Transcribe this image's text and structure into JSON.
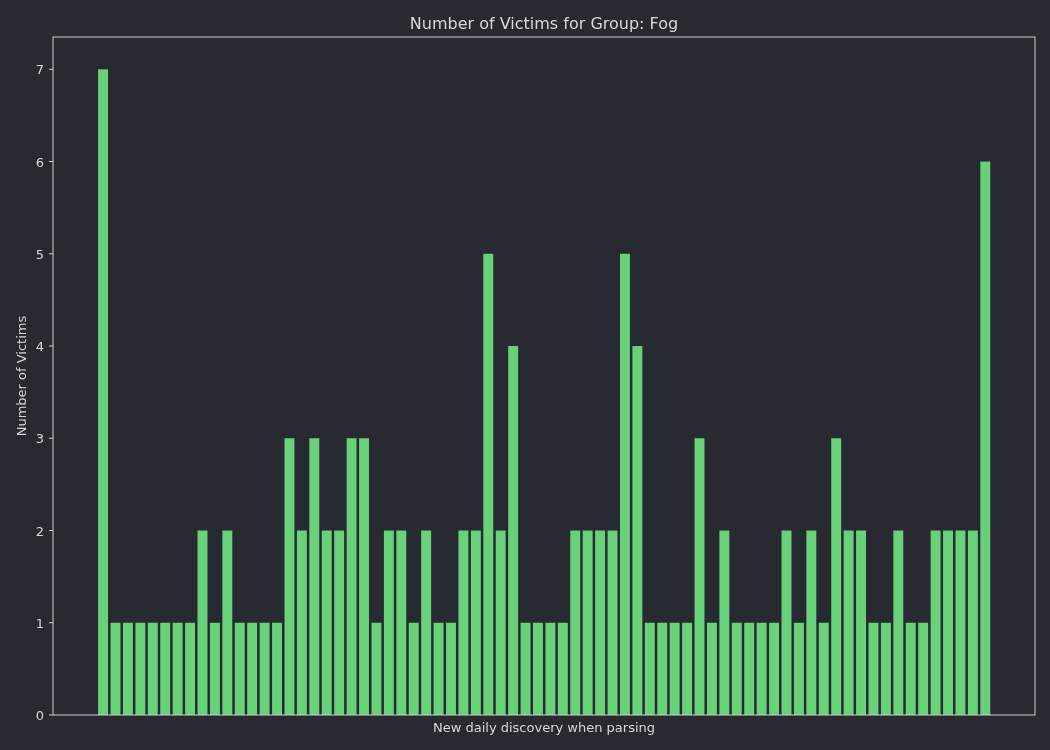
{
  "chart_data": {
    "type": "bar",
    "title": "Number of Victims for Group: Fog",
    "xlabel": "New daily discovery when parsing",
    "ylabel": "Number of Victims",
    "ylim": [
      0,
      7.35
    ],
    "yticks": [
      0,
      1,
      2,
      3,
      4,
      5,
      6,
      7
    ],
    "series": [
      {
        "color": "#68d17a",
        "values": [
          7,
          1,
          1,
          1,
          1,
          1,
          1,
          1,
          2,
          1,
          2,
          1,
          1,
          1,
          1,
          3,
          2,
          3,
          2,
          2,
          3,
          3,
          1,
          2,
          2,
          1,
          2,
          1,
          1,
          2,
          2,
          5,
          2,
          4,
          1,
          1,
          1,
          1,
          2,
          2,
          2,
          2,
          5,
          4,
          1,
          1,
          1,
          1,
          3,
          1,
          2,
          1,
          1,
          1,
          1,
          2,
          1,
          2,
          1,
          3,
          2,
          2,
          1,
          1,
          2,
          1,
          1,
          2,
          2,
          2,
          2,
          6
        ]
      }
    ]
  }
}
